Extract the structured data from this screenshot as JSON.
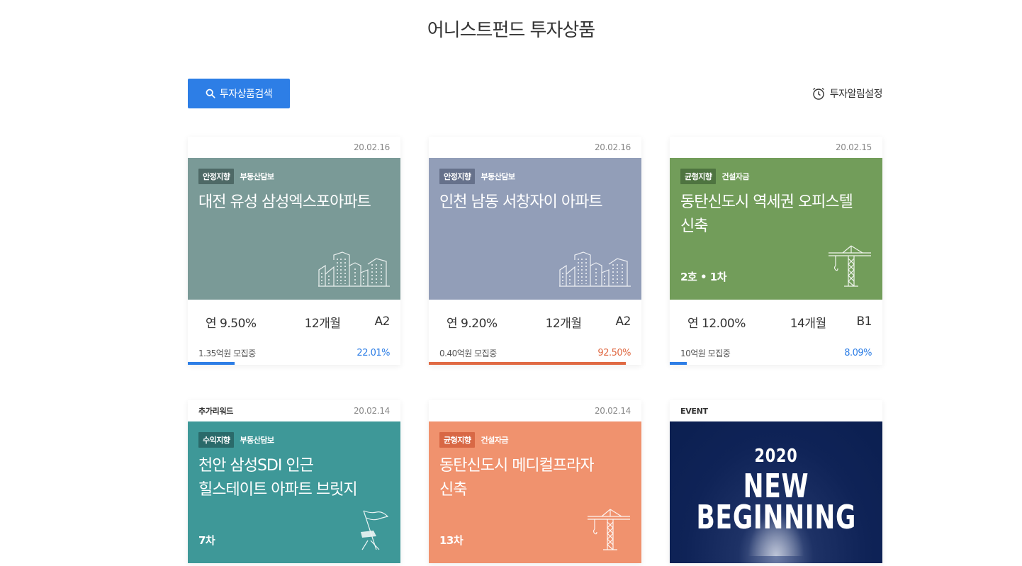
{
  "page": {
    "title": "어니스트펀드 투자상품"
  },
  "toolbar": {
    "search_label": "투자상품검색",
    "alarm_label": "투자알림설정"
  },
  "colors": {
    "accent": "#2d7ee6",
    "progress_orange": "#e06a44"
  },
  "cards": [
    {
      "date": "20.02.16",
      "top_tag": "",
      "badge_type": "안정지향",
      "badge_collateral": "부동산담보",
      "title_line1": "대전 유성 삼성엑스포아파트",
      "title_line2": "",
      "meta": "",
      "rate": "연 9.50%",
      "period": "12개월",
      "grade": "A2",
      "raised": "1.35억원 모집중",
      "progress_label": "22.01%",
      "progress": 22.01,
      "bg": "#7a9a97",
      "badge_bg": "#4e6966",
      "illustration": "buildings-icon"
    },
    {
      "date": "20.02.16",
      "top_tag": "",
      "badge_type": "안정지향",
      "badge_collateral": "부동산담보",
      "title_line1": "인천 남동 서창자이 아파트",
      "title_line2": "",
      "meta": "",
      "rate": "연 9.20%",
      "period": "12개월",
      "grade": "A2",
      "raised": "0.40억원 모집중",
      "progress_label": "92.50%",
      "progress": 92.5,
      "bg": "#929eb8",
      "badge_bg": "#66718b",
      "illustration": "buildings-icon"
    },
    {
      "date": "20.02.15",
      "top_tag": "",
      "badge_type": "균형지향",
      "badge_collateral": "건설자금",
      "title_line1": "동탄신도시 역세권 오피스텔",
      "title_line2": "신축",
      "meta": "2호 • 1차",
      "rate": "연 12.00%",
      "period": "14개월",
      "grade": "B1",
      "raised": "10억원 모집중",
      "progress_label": "8.09%",
      "progress": 8.09,
      "bg": "#729d5a",
      "badge_bg": "#4e7440",
      "illustration": "crane-icon"
    },
    {
      "date": "20.02.14",
      "top_tag": "추가리워드",
      "badge_type": "수익지향",
      "badge_collateral": "부동산담보",
      "title_line1": "천안 삼성SDI 인근",
      "title_line2": "힐스테이트 아파트 브릿지",
      "meta": "7차",
      "bg": "#3e9898",
      "badge_bg": "#2a6a6a",
      "illustration": "flag-icon"
    },
    {
      "date": "20.02.14",
      "top_tag": "",
      "badge_type": "균형지향",
      "badge_collateral": "건설자금",
      "title_line1": "동탄신도시 메디컬프라자",
      "title_line2": "신축",
      "meta": "13차",
      "bg": "#f0926e",
      "badge_bg": "#d86845",
      "illustration": "crane-icon"
    }
  ],
  "event_card": {
    "top_tag": "EVENT",
    "year": "2020",
    "line1": "NEW",
    "line2": "BEGINNING"
  }
}
